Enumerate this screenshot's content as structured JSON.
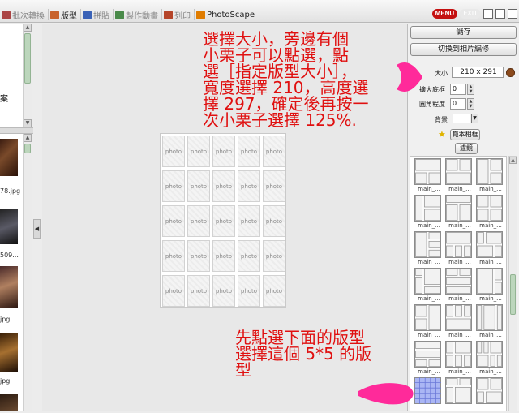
{
  "tabs": [
    {
      "label": "批次轉換",
      "active": false,
      "icon_color": "#a44"
    },
    {
      "label": "版型",
      "active": true,
      "icon_color": "#c8622b"
    },
    {
      "label": "拼貼",
      "active": false,
      "icon_color": "#3a62b7"
    },
    {
      "label": "製作動畫",
      "active": false,
      "icon_color": "#4a8a4a"
    },
    {
      "label": "列印",
      "active": false,
      "icon_color": "#b5452a"
    },
    {
      "label": "PhotoScape",
      "active": true,
      "icon_color": "#e07c00"
    }
  ],
  "top_icons": {
    "menu": "MENU",
    "exit": "EXIT"
  },
  "left_pane": {
    "case_char": "案",
    "files": [
      "78.jpg",
      "509...",
      "jpg",
      "jpg"
    ]
  },
  "canvas": {
    "cell_label": "photo",
    "rows": 5,
    "cols": 5
  },
  "right_panel": {
    "save_label": "儲存",
    "switch_label": "切換到相片編修",
    "size_label": "大小",
    "size_value": "210 x 291",
    "margin_label": "擴大底框",
    "margin_value": "0",
    "corner_label": "圓角程度",
    "corner_value": "0",
    "bg_label": "背景",
    "bg_color": "#ffffff",
    "sample_label": "範本相框",
    "filter_label": "濾鏡",
    "template_names": [
      "main_...",
      "main_...",
      "main_...",
      "main_...",
      "main_...",
      "main_...",
      "main_...",
      "main_...",
      "main_...",
      "main_...",
      "main_...",
      "main_...",
      "main_...",
      "main_...",
      "main_...",
      "main_...",
      "main_...",
      "main_...",
      "",
      "",
      ""
    ]
  },
  "annotations": {
    "top": "選擇大小，旁邊有個\n小栗子可以點選，點\n選［指定版型大小］，\n寬度選擇 210，高度選\n擇 297，確定後再按一\n次小栗子選擇 125%.",
    "bottom": "先點選下面的版型\n選擇這個 5*5 的版\n型",
    "color": "#e01010",
    "arrow_color": "#ff1493"
  }
}
